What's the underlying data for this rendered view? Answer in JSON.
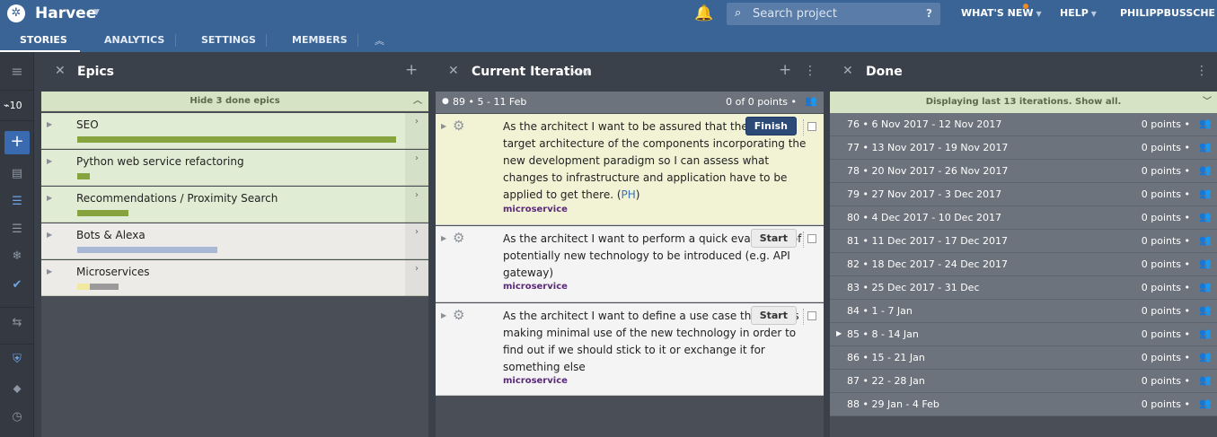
{
  "header": {
    "project_name": "Harvee",
    "search_placeholder": "Search project",
    "search_help": "?",
    "whats_new": "WHAT'S NEW",
    "help": "HELP",
    "user": "PHILIPPBUSSCHE"
  },
  "tabs": [
    {
      "label": "STORIES",
      "active": true
    },
    {
      "label": "ANALYTICS",
      "active": false
    },
    {
      "label": "SETTINGS",
      "active": false
    },
    {
      "label": "MEMBERS",
      "active": false
    }
  ],
  "rail": {
    "velocity": "10",
    "icons": [
      "menu-icon",
      "add-icon",
      "inbox-icon",
      "list-icon",
      "list-icon",
      "snowflake-icon",
      "check-icon",
      "arrows-icon",
      "shield-icon",
      "tag-icon",
      "clock-icon"
    ]
  },
  "epics_panel": {
    "title": "Epics",
    "banner": "Hide 3 done epics",
    "items": [
      {
        "name": "SEO",
        "style": "green",
        "bars": [
          {
            "color": "#86a33e",
            "fraction": 1.0
          }
        ]
      },
      {
        "name": "Python web service refactoring",
        "style": "green",
        "bars": [
          {
            "color": "#86a33e",
            "fraction": 0.04
          }
        ]
      },
      {
        "name": "Recommendations / Proximity Search",
        "style": "green",
        "bars": [
          {
            "color": "#86a33e",
            "fraction": 0.16
          }
        ]
      },
      {
        "name": "Bots & Alexa",
        "style": "gray",
        "bars": [
          {
            "color": "#a8b8d6",
            "fraction": 0.44
          }
        ]
      },
      {
        "name": "Microservices",
        "style": "gray",
        "bars": [
          {
            "color": "#f2e9a0",
            "fraction": 0.04
          },
          {
            "color": "#9a9a9a",
            "fraction": 0.09
          }
        ]
      }
    ]
  },
  "iteration_panel": {
    "title": "Current Iteration",
    "velocity": "10",
    "iteration_label": "89 • 5 - 11 Feb",
    "points": "0 of 0 points •",
    "stories": [
      {
        "text": "As the architect I want to be assured that there is a target architecture of the components incorporating the new development paradigm so I can assess what changes to infrastructure and application have to be applied to get there. (",
        "link": "PH",
        "suffix": ")",
        "tag": "microservice",
        "button": "Finish",
        "style": "yellow"
      },
      {
        "text": "As the architect I want to perform a quick evaluation of potentially new technology to be introduced (e.g. API gateway)",
        "link": "",
        "suffix": "",
        "tag": "microservice",
        "button": "Start",
        "style": "white"
      },
      {
        "text": "As the architect I want to define a use case that allows making minimal use of the new technology in order to find out if we should stick to it or exchange it for something else",
        "link": "",
        "suffix": "",
        "tag": "microservice",
        "button": "Start",
        "style": "white"
      }
    ]
  },
  "done_panel": {
    "title": "Done",
    "banner": "Displaying last 13 iterations. Show all.",
    "iterations": [
      {
        "label": "76 • 6 Nov 2017 - 12 Nov 2017",
        "points": "0 points •"
      },
      {
        "label": "77 • 13 Nov 2017 - 19 Nov 2017",
        "points": "0 points •"
      },
      {
        "label": "78 • 20 Nov 2017 - 26 Nov 2017",
        "points": "0 points •"
      },
      {
        "label": "79 • 27 Nov 2017 - 3 Dec 2017",
        "points": "0 points •"
      },
      {
        "label": "80 • 4 Dec 2017 - 10 Dec 2017",
        "points": "0 points •"
      },
      {
        "label": "81 • 11 Dec 2017 - 17 Dec 2017",
        "points": "0 points •"
      },
      {
        "label": "82 • 18 Dec 2017 - 24 Dec 2017",
        "points": "0 points •"
      },
      {
        "label": "83 • 25 Dec 2017 - 31 Dec",
        "points": "0 points •"
      },
      {
        "label": "84 • 1 - 7 Jan",
        "points": "0 points •"
      },
      {
        "label": "85 • 8 - 14 Jan",
        "points": "0 points •",
        "expand": true
      },
      {
        "label": "86 • 15 - 21 Jan",
        "points": "0 points •"
      },
      {
        "label": "87 • 22 - 28 Jan",
        "points": "0 points •"
      },
      {
        "label": "88 • 29 Jan - 4 Feb",
        "points": "0 points •"
      }
    ]
  }
}
